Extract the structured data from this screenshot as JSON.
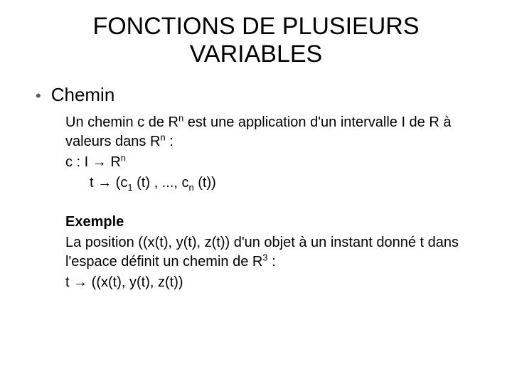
{
  "title_line1": "FONCTIONS DE PLUSIEURS",
  "title_line2": "VARIABLES",
  "section_heading": "Chemin",
  "definition": {
    "line1_pre": "Un chemin c de R",
    "line1_sup": "n",
    "line1_mid": " est une application d'un intervalle I de R à valeurs dans R",
    "line1_sup2": "n",
    "line1_post": " :",
    "map1_pre": "c   : I → R",
    "map1_sup": "n",
    "map2_pre": "t → (c",
    "map2_sub1": "1",
    "map2_mid": " (t) , ..., c",
    "map2_sub2": "n",
    "map2_post": " (t))"
  },
  "example": {
    "label": "Exemple",
    "line1_pre": "La position ((x(t), y(t), z(t)) d'un objet à un instant donné t dans l'espace définit un chemin de R",
    "line1_sup": "3",
    "line1_post": " :",
    "line2": "t → ((x(t), y(t), z(t))"
  }
}
